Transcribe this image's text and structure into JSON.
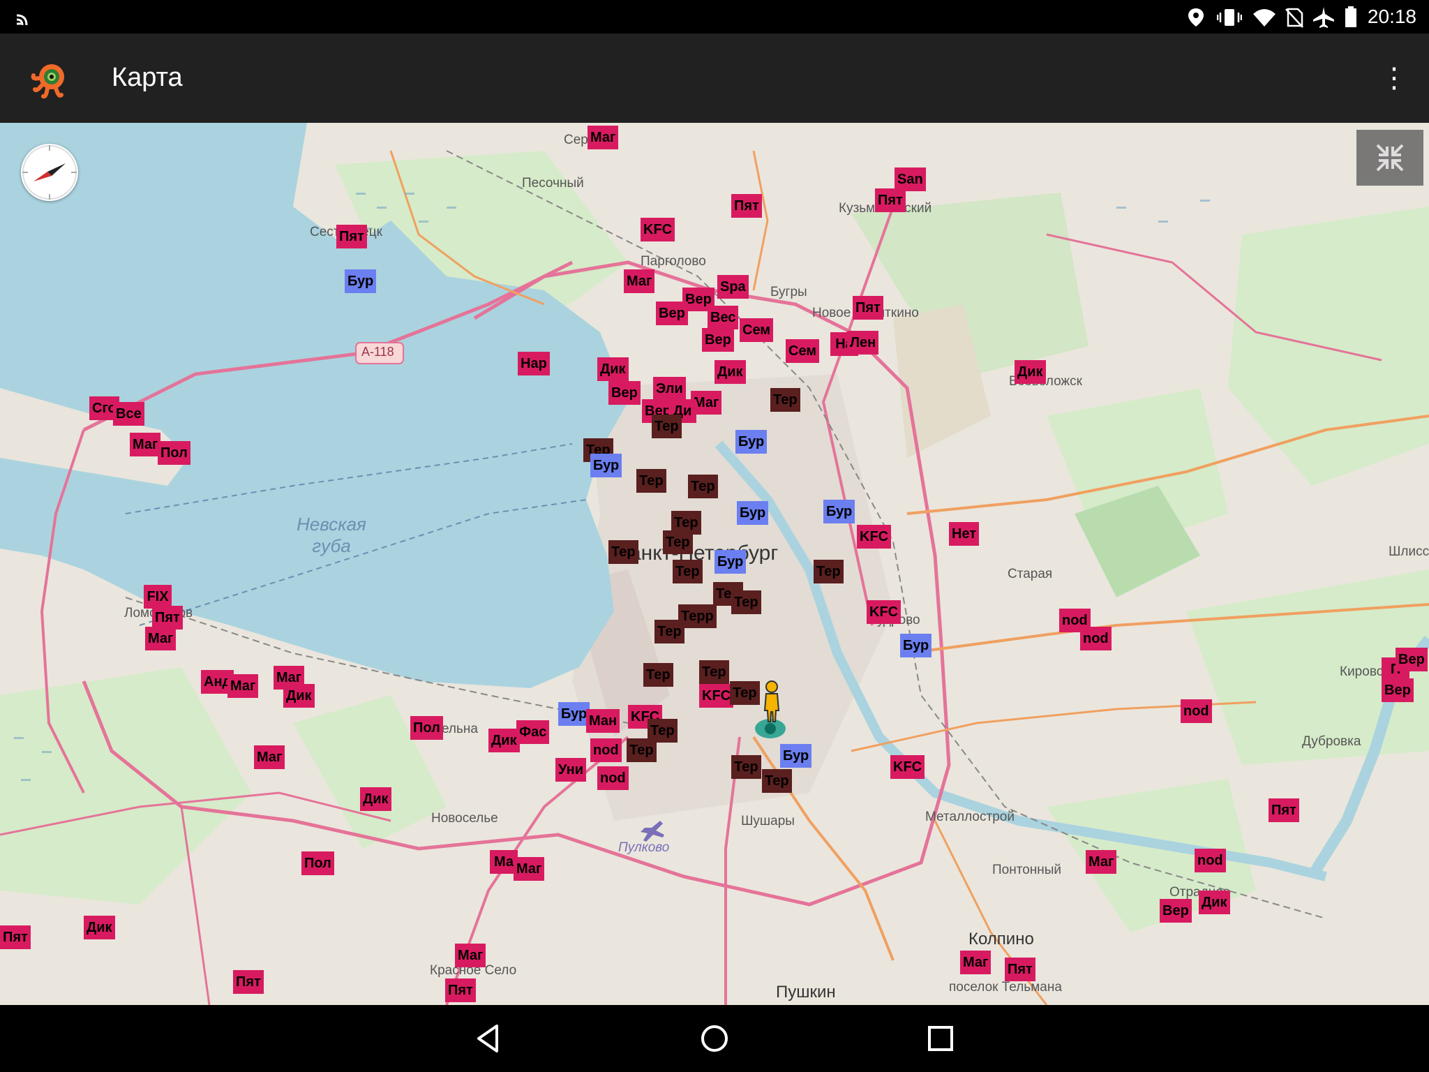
{
  "status_bar": {
    "time": "20:18",
    "icons": [
      "cast-icon",
      "location-icon",
      "vibrate-icon",
      "wifi-icon",
      "no-sim-icon",
      "airplane-icon",
      "battery-icon"
    ]
  },
  "toolbar": {
    "title": "Карта",
    "logo_icon": "app-logo-icon",
    "menu_icon": "overflow-menu-icon",
    "menu_glyph": "⋮"
  },
  "map": {
    "places": [
      "Серово",
      "Песочный",
      "Сестрорецк",
      "Парголово",
      "Бугры",
      "Новое Девяткино",
      "Кузьмоловский",
      "Всеволожск",
      "Санкт-Петербург",
      "Старая",
      "Кудрово",
      "Ломоносов",
      "Стрельна",
      "Новоселье",
      "Пулково",
      "Шушары",
      "Металлострой",
      "Понтонный",
      "Колпино",
      "Пушкин",
      "Красное Село",
      "Кировск",
      "Дубровка",
      "Шлиссельбург",
      "Отрадное",
      "поселок Тельмана"
    ],
    "sea_label": "Невская губа",
    "road_label": "А-118",
    "pois": [
      {
        "label": "Маг",
        "kind": "shop"
      },
      {
        "label": "San",
        "kind": "shop"
      },
      {
        "label": "Пят",
        "kind": "shop"
      },
      {
        "label": "Пят",
        "kind": "shop"
      },
      {
        "label": "KFC",
        "kind": "shop"
      },
      {
        "label": "Пят",
        "kind": "shop"
      },
      {
        "label": "Бур",
        "kind": "blue"
      },
      {
        "label": "Маг",
        "kind": "shop"
      },
      {
        "label": "Spa",
        "kind": "shop"
      },
      {
        "label": "Вер",
        "kind": "shop"
      },
      {
        "label": "Вер",
        "kind": "shop"
      },
      {
        "label": "Вес",
        "kind": "shop"
      },
      {
        "label": "Сем",
        "kind": "shop"
      },
      {
        "label": "Пят",
        "kind": "shop"
      },
      {
        "label": "Нар",
        "kind": "shop"
      },
      {
        "label": "Вер",
        "kind": "shop"
      },
      {
        "label": "Сем",
        "kind": "shop"
      },
      {
        "label": "На",
        "kind": "shop"
      },
      {
        "label": "Лен",
        "kind": "shop"
      },
      {
        "label": "Дик",
        "kind": "shop"
      },
      {
        "label": "Дик",
        "kind": "shop"
      },
      {
        "label": "Дик",
        "kind": "shop"
      },
      {
        "label": "Вер",
        "kind": "shop"
      },
      {
        "label": "Эли",
        "kind": "shop"
      },
      {
        "label": "Маг",
        "kind": "shop"
      },
      {
        "label": "Вер",
        "kind": "shop"
      },
      {
        "label": "Ди",
        "kind": "shop"
      },
      {
        "label": "Тер",
        "kind": "dark"
      },
      {
        "label": "Тер",
        "kind": "dark"
      },
      {
        "label": "Сго",
        "kind": "shop"
      },
      {
        "label": "Все",
        "kind": "shop"
      },
      {
        "label": "Маг",
        "kind": "shop"
      },
      {
        "label": "Пол",
        "kind": "shop"
      },
      {
        "label": "Тер",
        "kind": "dark"
      },
      {
        "label": "Бур",
        "kind": "blue"
      },
      {
        "label": "Бур",
        "kind": "blue"
      },
      {
        "label": "Тер",
        "kind": "dark"
      },
      {
        "label": "Тер",
        "kind": "dark"
      },
      {
        "label": "Бур",
        "kind": "blue"
      },
      {
        "label": "Бур",
        "kind": "blue"
      },
      {
        "label": "KFC",
        "kind": "shop"
      },
      {
        "label": "Нет",
        "kind": "shop"
      },
      {
        "label": "Тер",
        "kind": "dark"
      },
      {
        "label": "Тер",
        "kind": "dark"
      },
      {
        "label": "Тер",
        "kind": "dark"
      },
      {
        "label": "Тер",
        "kind": "dark"
      },
      {
        "label": "Бур",
        "kind": "blue"
      },
      {
        "label": "Тер",
        "kind": "dark"
      },
      {
        "label": "Тер",
        "kind": "dark"
      },
      {
        "label": "Тер",
        "kind": "dark"
      },
      {
        "label": "Терр",
        "kind": "dark"
      },
      {
        "label": "KFC",
        "kind": "shop"
      },
      {
        "label": "Тер",
        "kind": "dark"
      },
      {
        "label": "Бур",
        "kind": "blue"
      },
      {
        "label": "nod",
        "kind": "shop"
      },
      {
        "label": "nod",
        "kind": "shop"
      },
      {
        "label": "FIX",
        "kind": "shop"
      },
      {
        "label": "Пят",
        "kind": "shop"
      },
      {
        "label": "Маг",
        "kind": "shop"
      },
      {
        "label": "Анд",
        "kind": "shop"
      },
      {
        "label": "Маг",
        "kind": "shop"
      },
      {
        "label": "Мaг",
        "kind": "shop"
      },
      {
        "label": "Дик",
        "kind": "shop"
      },
      {
        "label": "Тер",
        "kind": "dark"
      },
      {
        "label": "Тер",
        "kind": "dark"
      },
      {
        "label": "KFC",
        "kind": "shop"
      },
      {
        "label": "Тер",
        "kind": "dark"
      },
      {
        "label": "П",
        "kind": "shop"
      },
      {
        "label": "Вер",
        "kind": "shop"
      },
      {
        "label": "Вер",
        "kind": "shop"
      },
      {
        "label": "nod",
        "kind": "shop"
      },
      {
        "label": "Бур",
        "kind": "blue"
      },
      {
        "label": "Ман",
        "kind": "shop"
      },
      {
        "label": "KFC",
        "kind": "shop"
      },
      {
        "label": "Тер",
        "kind": "dark"
      },
      {
        "label": "Пол",
        "kind": "shop"
      },
      {
        "label": "Фас",
        "kind": "shop"
      },
      {
        "label": "Дик",
        "kind": "shop"
      },
      {
        "label": "nod",
        "kind": "shop"
      },
      {
        "label": "Тер",
        "kind": "dark"
      },
      {
        "label": "Маг",
        "kind": "shop"
      },
      {
        "label": "Уни",
        "kind": "shop"
      },
      {
        "label": "nod",
        "kind": "shop"
      },
      {
        "label": "Бур",
        "kind": "blue"
      },
      {
        "label": "Тер",
        "kind": "dark"
      },
      {
        "label": "Тер",
        "kind": "dark"
      },
      {
        "label": "KFC",
        "kind": "shop"
      },
      {
        "label": "Дик",
        "kind": "shop"
      },
      {
        "label": "Пят",
        "kind": "shop"
      },
      {
        "label": "Пол",
        "kind": "shop"
      },
      {
        "label": "Ма",
        "kind": "shop"
      },
      {
        "label": "Маг",
        "kind": "shop"
      },
      {
        "label": "Маг",
        "kind": "shop"
      },
      {
        "label": "nod",
        "kind": "shop"
      },
      {
        "label": "Вер",
        "kind": "shop"
      },
      {
        "label": "Дик",
        "kind": "shop"
      },
      {
        "label": "Пят",
        "kind": "shop"
      },
      {
        "label": "Дик",
        "kind": "shop"
      },
      {
        "label": "Маг",
        "kind": "shop"
      },
      {
        "label": "Пят",
        "kind": "shop"
      },
      {
        "label": "Маг",
        "kind": "shop"
      },
      {
        "label": "Пят",
        "kind": "shop"
      },
      {
        "label": "Пят",
        "kind": "shop"
      }
    ],
    "compass_icon": "compass-icon",
    "collapse_icon": "collapse-icon",
    "user_marker_icon": "pegman-icon"
  },
  "nav_bar": {
    "back_icon": "back-icon",
    "home_icon": "home-icon",
    "recents_icon": "recents-icon"
  },
  "colors": {
    "shop": "#d81b60",
    "dark": "#5a1f1f",
    "blue": "#6b7ff0",
    "water": "#aad3df",
    "land": "#e9e5dc",
    "forest": "#cde6c0",
    "route": "#e57399"
  }
}
